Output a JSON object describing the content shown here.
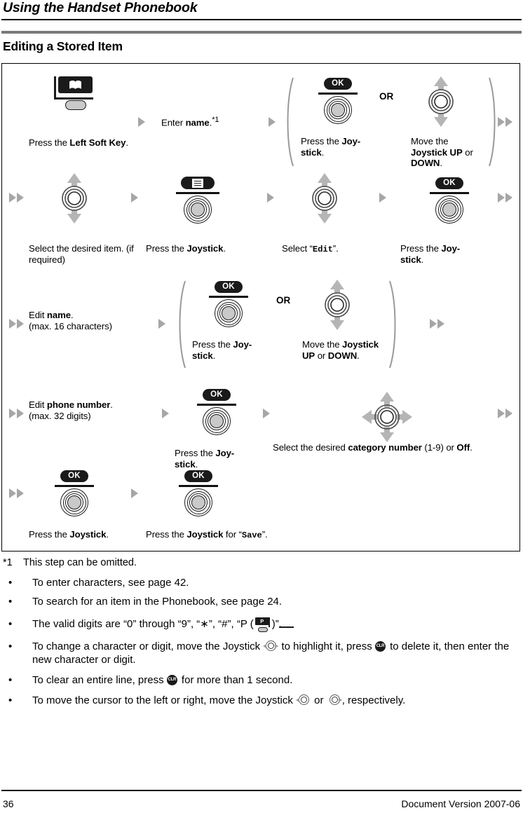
{
  "header": {
    "running_head": "Using the Handset Phonebook",
    "section_title": "Editing a Stored Item"
  },
  "diagram": {
    "steps": [
      {
        "id": "s1",
        "icon": "left-soft-key-icon",
        "caption_html": "Press the <b>Left Soft Key</b>."
      },
      {
        "id": "s2",
        "icon": "none",
        "caption_html": "Enter <b>name</b>.<sup>*1</sup>"
      },
      {
        "id": "s3",
        "icon": "joystick-ok-icon",
        "caption_html": "Press the <b>Joy-stick</b>."
      },
      {
        "id": "s4",
        "icon": "joystick-updown-icon",
        "caption_html": "Move the <b>Joystick UP</b> or <b>DOWN</b>."
      },
      {
        "id": "s5",
        "icon": "joystick-updown-icon",
        "caption_html": "Select the desired item. (if required)"
      },
      {
        "id": "s6",
        "icon": "joystick-menu-icon",
        "caption_html": "Press the <b>Joystick</b>."
      },
      {
        "id": "s7",
        "icon": "joystick-updown-icon",
        "caption_html": "Select “<span class=\"mono\">Edit</span>”."
      },
      {
        "id": "s8",
        "icon": "joystick-ok-icon",
        "caption_html": "Press the <b>Joy-stick</b>."
      },
      {
        "id": "s9",
        "icon": "none",
        "caption_html": "Edit <b>name</b>.<br>(max. 16 characters)"
      },
      {
        "id": "s10",
        "icon": "joystick-ok-icon",
        "caption_html": "Press the <b>Joy-stick</b>."
      },
      {
        "id": "s11",
        "icon": "joystick-updown-icon",
        "caption_html": "Move the <b>Joystick UP</b> or <b>DOWN</b>."
      },
      {
        "id": "s12",
        "icon": "none",
        "caption_html": "Edit <b>phone number</b>.<br>(max. 32 digits)"
      },
      {
        "id": "s13",
        "icon": "joystick-ok-icon",
        "caption_html": "Press the <b>Joy-stick</b>."
      },
      {
        "id": "s14",
        "icon": "joystick-fourway-icon",
        "caption_html": "Select the desired <b>category number</b> (1-9) or <b>Off</b>."
      },
      {
        "id": "s15",
        "icon": "joystick-ok-icon",
        "caption_html": "Press the <b>Joystick</b>."
      },
      {
        "id": "s16",
        "icon": "joystick-ok-icon",
        "caption_html": "Press the <b>Joystick</b> for “<span class=\"mono\">Save</span>”."
      }
    ],
    "or_label_1": "OR",
    "or_label_2": "OR",
    "ok_label": "OK"
  },
  "notes": {
    "footnote_marker": "*1",
    "footnote_text": "This step can be omitted.",
    "bullets": [
      {
        "id": "b1",
        "html": "To enter characters, see page 42."
      },
      {
        "id": "b2",
        "html": "To search for an item in the Phonebook, see page 24."
      },
      {
        "id": "b3",
        "html": "The valid digits are “0” through “9”, “∗”, “#”, “P (<span class=\"pkey\" data-name=\"p-key-icon\"><span class=\"blk\">P</span><span class=\"rc\"></span><span class=\"bt\"></span><span class=\"ob\"></span></span>)”."
      },
      {
        "id": "b4",
        "html": "To change a character or digit, move the Joystick <span class=\"ijoy\" data-name=\"joystick-left-right-inline-icon\"><span class=\"c\"></span><span class=\"c2\"></span><span class=\"ar arL\"></span><span class=\"ar arR\"></span></span> to highlight it, press <span class=\"iclr\" data-name=\"clear-key-inline-icon\"><span class=\"c\">CLR</span></span> to delete it, then enter the new character or digit."
      },
      {
        "id": "b5",
        "html": "To clear an entire line, press <span class=\"iclr\" data-name=\"clear-key-inline-icon\"><span class=\"c\">CLR</span></span> for more than 1 second."
      },
      {
        "id": "b6",
        "html": "To move the cursor to the left or right, move the Joystick <span class=\"ijoy\" data-name=\"joystick-left-inline-icon\"><span class=\"c\"></span><span class=\"c2\"></span><span class=\"ar arL\"></span></span> or <span class=\"ijoy\" data-name=\"joystick-right-inline-icon\"><span class=\"c\"></span><span class=\"c2\"></span><span class=\"ar arR\"></span></span>, respectively."
      }
    ],
    "bullet_char": "•"
  },
  "footer": {
    "page_number": "36",
    "document_version": "Document Version 2007-06"
  },
  "colors": {
    "rule_gray": "#7a7a7a",
    "arrow_gray": "#a6a6a6",
    "chip_black": "#1a1a1a",
    "hub_gray": "#c9c9c9"
  }
}
